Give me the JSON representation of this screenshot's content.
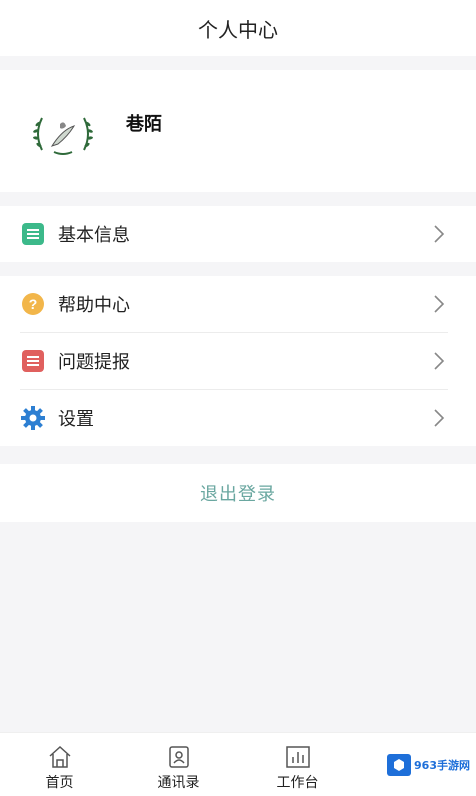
{
  "header": {
    "title": "个人中心"
  },
  "profile": {
    "name": "巷陌",
    "avatar_icon": "wreath-logo-icon"
  },
  "section_basic": {
    "items": [
      {
        "label": "基本信息",
        "icon": "clipboard-icon",
        "color": "#3cb98a"
      }
    ]
  },
  "section_support": {
    "items": [
      {
        "label": "帮助中心",
        "icon": "help-icon",
        "color": "#f2b64a"
      },
      {
        "label": "问题提报",
        "icon": "report-icon",
        "color": "#e0605e"
      },
      {
        "label": "设置",
        "icon": "gear-icon",
        "color": "#2d7fd2"
      }
    ]
  },
  "logout": {
    "label": "退出登录",
    "color": "#6aa7a0"
  },
  "tabbar": {
    "tabs": [
      {
        "label": "首页",
        "icon": "home-icon"
      },
      {
        "label": "通讯录",
        "icon": "contacts-icon"
      },
      {
        "label": "工作台",
        "icon": "dashboard-icon"
      }
    ]
  },
  "watermark": {
    "text": "963手游网"
  }
}
